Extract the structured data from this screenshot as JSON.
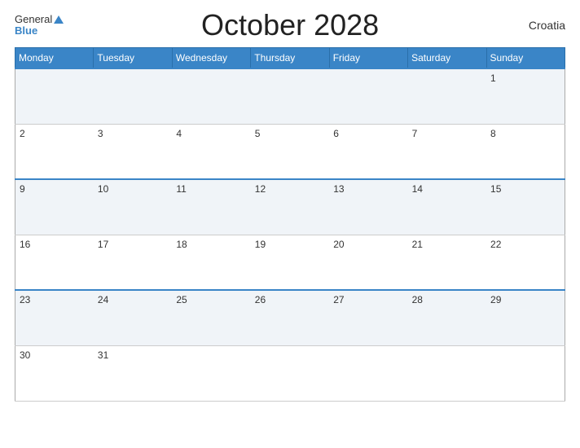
{
  "header": {
    "logo_general": "General",
    "logo_blue": "Blue",
    "title": "October 2028",
    "country": "Croatia"
  },
  "calendar": {
    "days_of_week": [
      "Monday",
      "Tuesday",
      "Wednesday",
      "Thursday",
      "Friday",
      "Saturday",
      "Sunday"
    ],
    "weeks": [
      [
        "",
        "",
        "",
        "",
        "",
        "",
        "1"
      ],
      [
        "2",
        "3",
        "4",
        "5",
        "6",
        "7",
        "8"
      ],
      [
        "9",
        "10",
        "11",
        "12",
        "13",
        "14",
        "15"
      ],
      [
        "16",
        "17",
        "18",
        "19",
        "20",
        "21",
        "22"
      ],
      [
        "23",
        "24",
        "25",
        "26",
        "27",
        "28",
        "29"
      ],
      [
        "30",
        "31",
        "",
        "",
        "",
        "",
        ""
      ]
    ]
  }
}
